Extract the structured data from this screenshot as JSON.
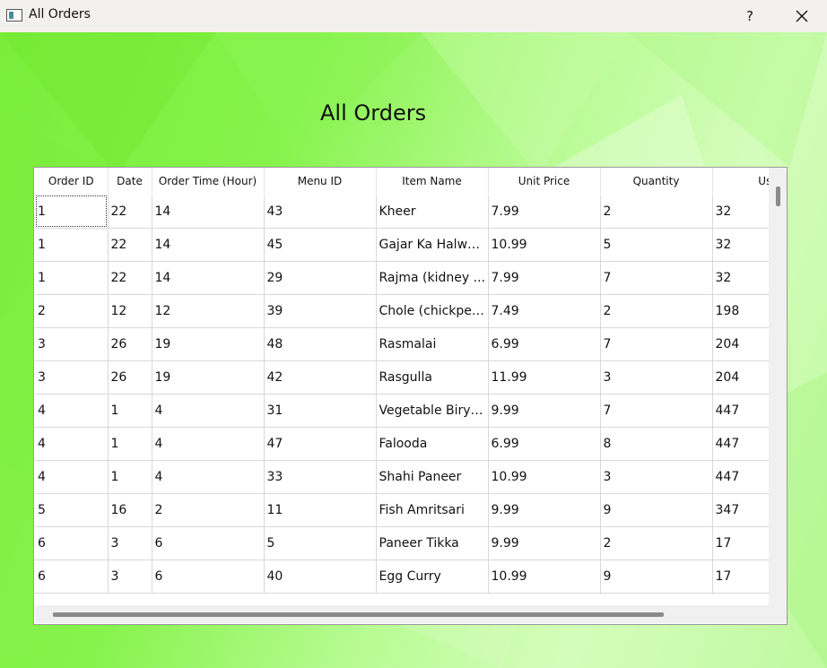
{
  "window": {
    "title": "All Orders",
    "help_label": "?",
    "close_icon": "close-icon"
  },
  "heading": "All Orders",
  "table": {
    "columns": [
      "Order ID",
      "Date",
      "Order Time (Hour)",
      "Menu ID",
      "Item Name",
      "Unit Price",
      "Quantity",
      "Use"
    ],
    "rows": [
      [
        "1",
        "22",
        "14",
        "43",
        "Kheer",
        "7.99",
        "2",
        "32"
      ],
      [
        "1",
        "22",
        "14",
        "45",
        "Gajar Ka Halwa ...",
        "10.99",
        "5",
        "32"
      ],
      [
        "1",
        "22",
        "14",
        "29",
        "Rajma (kidney ...",
        "7.99",
        "7",
        "32"
      ],
      [
        "2",
        "12",
        "12",
        "39",
        "Chole (chickpea...",
        "7.49",
        "2",
        "198"
      ],
      [
        "3",
        "26",
        "19",
        "48",
        "Rasmalai",
        "6.99",
        "7",
        "204"
      ],
      [
        "3",
        "26",
        "19",
        "42",
        "Rasgulla",
        "11.99",
        "3",
        "204"
      ],
      [
        "4",
        "1",
        "4",
        "31",
        "Vegetable Biryani",
        "9.99",
        "7",
        "447"
      ],
      [
        "4",
        "1",
        "4",
        "47",
        "Falooda",
        "6.99",
        "8",
        "447"
      ],
      [
        "4",
        "1",
        "4",
        "33",
        "Shahi Paneer",
        "10.99",
        "3",
        "447"
      ],
      [
        "5",
        "16",
        "2",
        "11",
        "Fish Amritsari",
        "9.99",
        "9",
        "347"
      ],
      [
        "6",
        "3",
        "6",
        "5",
        "Paneer Tikka",
        "9.99",
        "2",
        "17"
      ],
      [
        "6",
        "3",
        "6",
        "40",
        "Egg Curry",
        "10.99",
        "9",
        "17"
      ]
    ]
  }
}
